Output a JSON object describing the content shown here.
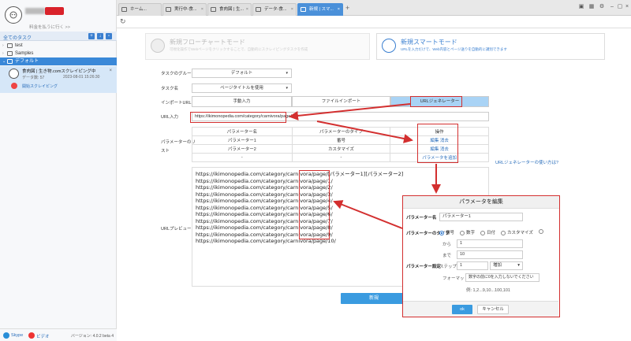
{
  "sidebar": {
    "invite": "料金を払うに行く >>",
    "tasks_header": "全てのタスク",
    "folders": [
      {
        "label": "test"
      },
      {
        "label": "Samples"
      },
      {
        "label": "デフォルト"
      }
    ],
    "task": {
      "name": "食肉図 | 生き物.comスクレイピング中",
      "count": "データ数: 57",
      "date": "2023-08-01 15:26:30",
      "status": "開始スクレイピング"
    },
    "footer": {
      "skype": "Skype",
      "video": "ビデオ",
      "version": "バージョン: 4.0.2 beta 4"
    }
  },
  "tabs": [
    {
      "label": "ホーム..."
    },
    {
      "label": "実行中-食..."
    },
    {
      "label": "食肉図 | 生..."
    },
    {
      "label": "データ-食..."
    },
    {
      "label": "新規 | スマ..."
    }
  ],
  "modes": {
    "flowchart": {
      "title": "新規フローチャートモード",
      "desc": "可視化操作でWebページをクリックすることで、自動的にスクレイピングタスクを作成"
    },
    "smart": {
      "title": "新規スマートモード",
      "desc": "URLを入力だけで、Web内容とページ送りを自動的に識別できます"
    }
  },
  "form": {
    "group_label": "タスクのグループ",
    "group_value": "デフォルト",
    "name_label": "タスク名",
    "name_value": "ページタイトルを使用",
    "import_label": "インポートURL",
    "import_options": [
      "手動入力",
      "ファイルインポート",
      "URLジェネレーター"
    ],
    "url_label": "URL入力",
    "url_value": "https://ikimonopedia.com/category/carnivora/page/",
    "param_list_label_1": "パラメーターのリ",
    "param_list_label_2": "スト",
    "table_headers": [
      "パラメーター名",
      "パラメーターのタイプ",
      "操作"
    ],
    "table_rows": [
      {
        "name": "パラメーター1",
        "type": "番号",
        "edit": "編集",
        "delete": "消去"
      },
      {
        "name": "パラメーター2",
        "type": "カスタマイズ",
        "edit": "編集",
        "delete": "消去"
      },
      {
        "name": "-",
        "type": "-",
        "add": "パラメータを追加"
      }
    ],
    "help_link": "URLジェネレーターの使い方は?",
    "preview_label": "URLプレビュー",
    "preview_lines": [
      "https://ikimonopedia.com/category/carnivora/page/[パラメーター1][パラメーター2]",
      "https://ikimonopedia.com/category/carnivora/page/1/",
      "https://ikimonopedia.com/category/carnivora/page/2/",
      "https://ikimonopedia.com/category/carnivora/page/3/",
      "https://ikimonopedia.com/category/carnivora/page/4/",
      "https://ikimonopedia.com/category/carnivora/page/5/",
      "https://ikimonopedia.com/category/carnivora/page/6/",
      "https://ikimonopedia.com/category/carnivora/page/7/",
      "https://ikimonopedia.com/category/carnivora/page/8/",
      "https://ikimonopedia.com/category/carnivora/page/9/",
      "https://ikimonopedia.com/category/carnivora/page/10/"
    ],
    "save": "新規"
  },
  "dialog": {
    "title": "パラメータを編集",
    "name_label": "パラメーター名",
    "name_value": "パラメーター1",
    "type_label": "パラメーターのタイプ",
    "types": [
      "番号",
      "数字",
      "日付",
      "カスタマイズ"
    ],
    "from_label": "から",
    "from_value": "1",
    "to_label": "まで",
    "to_value": "10",
    "settings_label": "パラメーター設定",
    "step_label": "ステップ",
    "step_value": "1",
    "order": "増加",
    "format_label": "フォーマット",
    "format_value": "数字の前に0を入力しないでください",
    "example": "例: 1,2...9,10...100,101",
    "ok": "ok",
    "cancel": "キャンセル"
  },
  "colors": {
    "accent": "#3a9be0",
    "annotation": "#d32f2f"
  }
}
